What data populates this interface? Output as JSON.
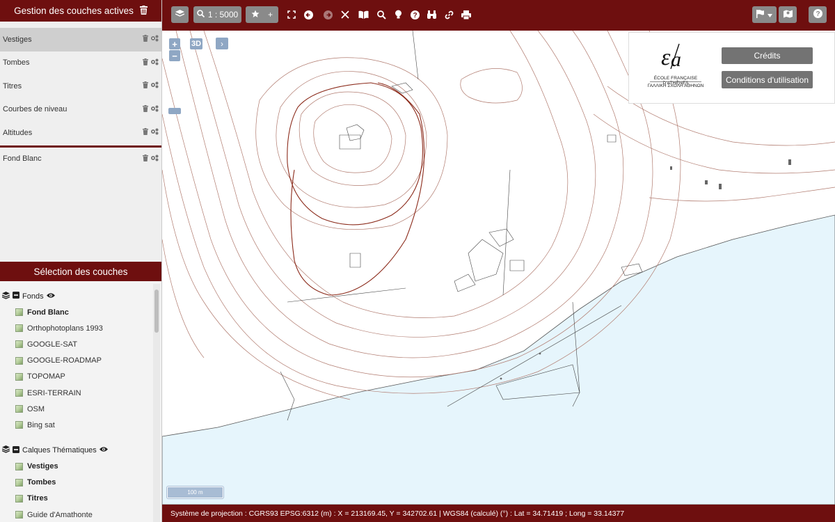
{
  "sidebar": {
    "active_header": "Gestion des couches actives",
    "active_layers": [
      {
        "label": "Vestiges",
        "selected": true
      },
      {
        "label": "Tombes",
        "selected": false
      },
      {
        "label": "Titres",
        "selected": false
      },
      {
        "label": "Courbes de niveau",
        "selected": false
      },
      {
        "label": "Altitudes",
        "selected": false
      }
    ],
    "base_active_layer": "Fond Blanc",
    "selection_header": "Sélection des couches",
    "groups": [
      {
        "title": "Fonds",
        "items": [
          {
            "label": "Fond Blanc",
            "bold": true
          },
          {
            "label": "Orthophotoplans 1993",
            "bold": false
          },
          {
            "label": "GOOGLE-SAT",
            "bold": false
          },
          {
            "label": "GOOGLE-ROADMAP",
            "bold": false
          },
          {
            "label": "TOPOMAP",
            "bold": false
          },
          {
            "label": "ESRI-TERRAIN",
            "bold": false
          },
          {
            "label": "OSM",
            "bold": false
          },
          {
            "label": "Bing sat",
            "bold": false
          }
        ]
      },
      {
        "title": "Calques Thématiques",
        "items": [
          {
            "label": "Vestiges",
            "bold": true
          },
          {
            "label": "Tombes",
            "bold": true
          },
          {
            "label": "Titres",
            "bold": true
          },
          {
            "label": "Guide d'Amathonte",
            "bold": false
          }
        ]
      }
    ]
  },
  "toolbar": {
    "scale_label": "1 : 5000",
    "plus_label": "+"
  },
  "map": {
    "zoom_in": "+",
    "zoom_out": "−",
    "btn_3d": "3D",
    "expand": "›",
    "scale_bar": "100 m",
    "logo_line1": "ÉCOLE FRANÇAISE D'ATHÈNES",
    "logo_line2": "ΓΑΛΛΙΚΗ ΣΧΟΛΗ ΑΘΗΝΩΝ",
    "credits": "Crédits",
    "conditions": "Conditions d'utilisation",
    "colors": {
      "sea": "#e6f5fc",
      "contour": "#b07a6e",
      "contour_main": "#8b2a1a",
      "accent": "#6e0f0f"
    }
  },
  "status": {
    "text": "Système de projection : CGRS93 EPSG:6312 (m) : X = 213169.45, Y = 342702.61 | WGS84 (calculé) (°) : Lat = 34.71419 ; Long = 33.14377"
  }
}
